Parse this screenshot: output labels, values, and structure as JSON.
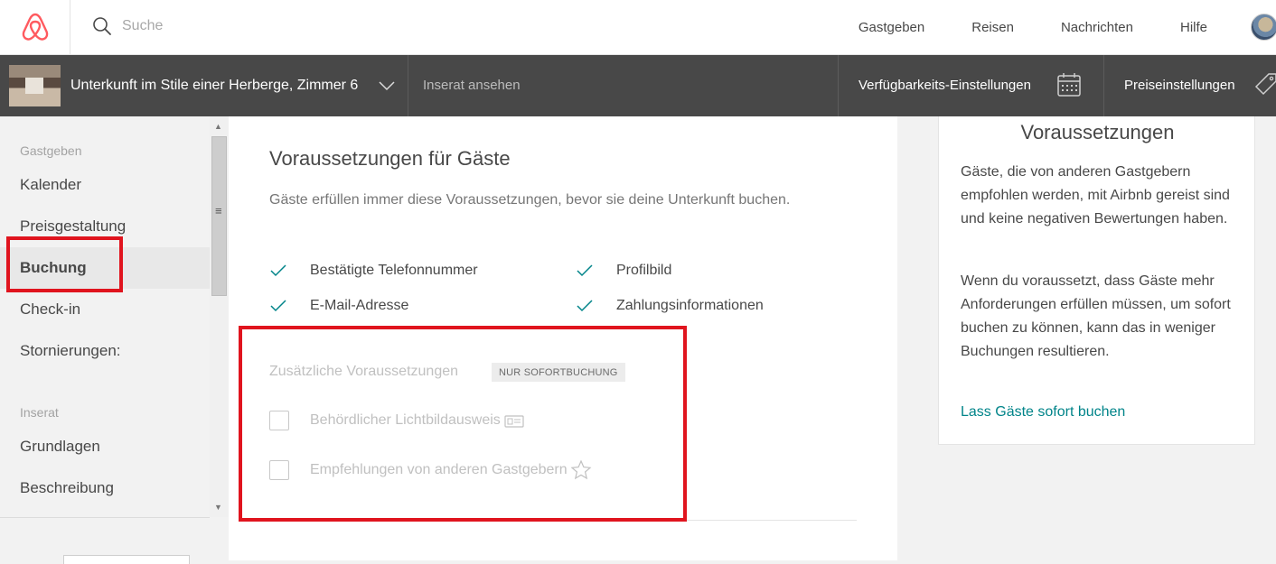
{
  "topnav": {
    "search_placeholder": "Suche",
    "links": [
      "Gastgeben",
      "Reisen",
      "Nachrichten",
      "Hilfe"
    ]
  },
  "listing": {
    "name": "Unterkunft im Stile einer Herberge, Zimmer 6",
    "view_listing": "Inserat ansehen",
    "availability": "Verfügbarkeits-Einstellungen",
    "pricing": "Preiseinstellungen"
  },
  "sidebar": {
    "section_host": "Gastgeben",
    "host_items": [
      "Kalender",
      "Preisgestaltung",
      "Buchung",
      "Check-in",
      "Stornierungen:"
    ],
    "section_listing": "Inserat",
    "listing_items": [
      "Grundlagen",
      "Beschreibung"
    ]
  },
  "main": {
    "title": "Voraussetzungen für Gäste",
    "subtitle": "Gäste erfüllen immer diese Voraussetzungen, bevor sie deine Unterkunft buchen.",
    "requirements": [
      "Bestätigte Telefonnummer",
      "Profilbild",
      "E-Mail-Adresse",
      "Zahlungsinformationen"
    ],
    "additional_title": "Zusätzliche Voraussetzungen",
    "badge": "NUR SOFORTBUCHUNG",
    "options": [
      {
        "label": "Behördlicher Lichtbildausweis",
        "icon": "id-card-icon",
        "checked": false
      },
      {
        "label": "Empfehlungen von anderen Gastgebern",
        "icon": "star-icon",
        "checked": false
      }
    ]
  },
  "panel": {
    "title": "Voraussetzungen",
    "para1": "Gäste, die von anderen Gastgebern empfohlen werden, mit Airbnb gereist sind und keine negativen Bewertungen haben.",
    "para2": "Wenn du voraussetzt, dass Gäste mehr Anforderungen erfüllen müssen, um sofort buchen zu können, kann das in weniger Buchungen resultieren.",
    "link": "Lass Gäste sofort buchen"
  },
  "colors": {
    "brand": "#ff5a5f",
    "teal": "#008489",
    "highlight": "#e0141e"
  }
}
